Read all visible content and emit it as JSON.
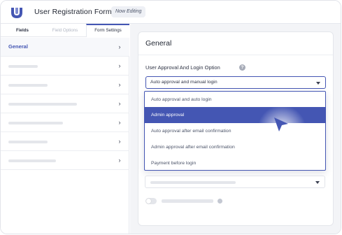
{
  "header": {
    "title": "User Registration Form",
    "status_badge": "Now Editing"
  },
  "sidebar": {
    "tabs": [
      {
        "label": "Fields"
      },
      {
        "label": "Field Options"
      },
      {
        "label": "Form Settings"
      }
    ],
    "items": [
      {
        "label": "General",
        "active": true
      }
    ]
  },
  "main": {
    "section_title": "General",
    "field_label": "User Approval And Login Option",
    "help_icon_glyph": "?",
    "select_value": "Auto approval and manual login",
    "dropdown_options": [
      "Auto approval and auto login",
      "Admin approval",
      "Auto approval after email confirmation",
      "Admin approval after email confirmation",
      "Payment before login"
    ],
    "selected_option": "Admin approval"
  },
  "icons": {
    "chevron": "›"
  },
  "colors": {
    "accent": "#4456b3",
    "accent_text": "#4456b3"
  }
}
